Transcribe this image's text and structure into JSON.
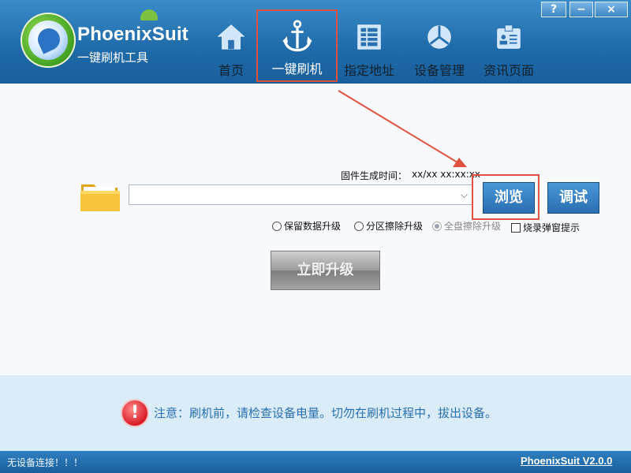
{
  "app": {
    "name": "PhoenixSuit",
    "subtitle": "一键刷机工具"
  },
  "window_buttons": {
    "help": "?",
    "minimize": "−",
    "close": "×"
  },
  "nav": {
    "items": [
      {
        "label": "首页",
        "icon": "home-icon"
      },
      {
        "label": "一键刷机",
        "icon": "anchor-icon"
      },
      {
        "label": "指定地址",
        "icon": "grid-icon"
      },
      {
        "label": "设备管理",
        "icon": "device-icon"
      },
      {
        "label": "资讯页面",
        "icon": "news-icon"
      }
    ],
    "active_index": 1
  },
  "firmware": {
    "build_time_label": "固件生成时间：",
    "build_time_value": "xx/xx xx:xx:xx",
    "file_path": ""
  },
  "buttons": {
    "browse": "浏览",
    "debug": "调试",
    "upgrade": "立即升级"
  },
  "options": {
    "radio": [
      {
        "label": "保留数据升级",
        "checked": false,
        "disabled": false
      },
      {
        "label": "分区擦除升级",
        "checked": false,
        "disabled": false
      },
      {
        "label": "全盘擦除升级",
        "checked": true,
        "disabled": true
      }
    ],
    "popup_checkbox": {
      "label": "烧录弹窗提示",
      "checked": false
    }
  },
  "notice": {
    "text": "注意：刷机前，请检查设备电量。切勿在刷机过程中，拔出设备。",
    "icon": "warning-icon"
  },
  "status": {
    "text": "无设备连接！！！",
    "version": "PhoenixSuit V2.0.0"
  },
  "colors": {
    "header": "#1f6aa8",
    "highlight": "#e0523f",
    "notice_text": "#2a6fb1",
    "notice_bg": "#d9ecf7"
  }
}
